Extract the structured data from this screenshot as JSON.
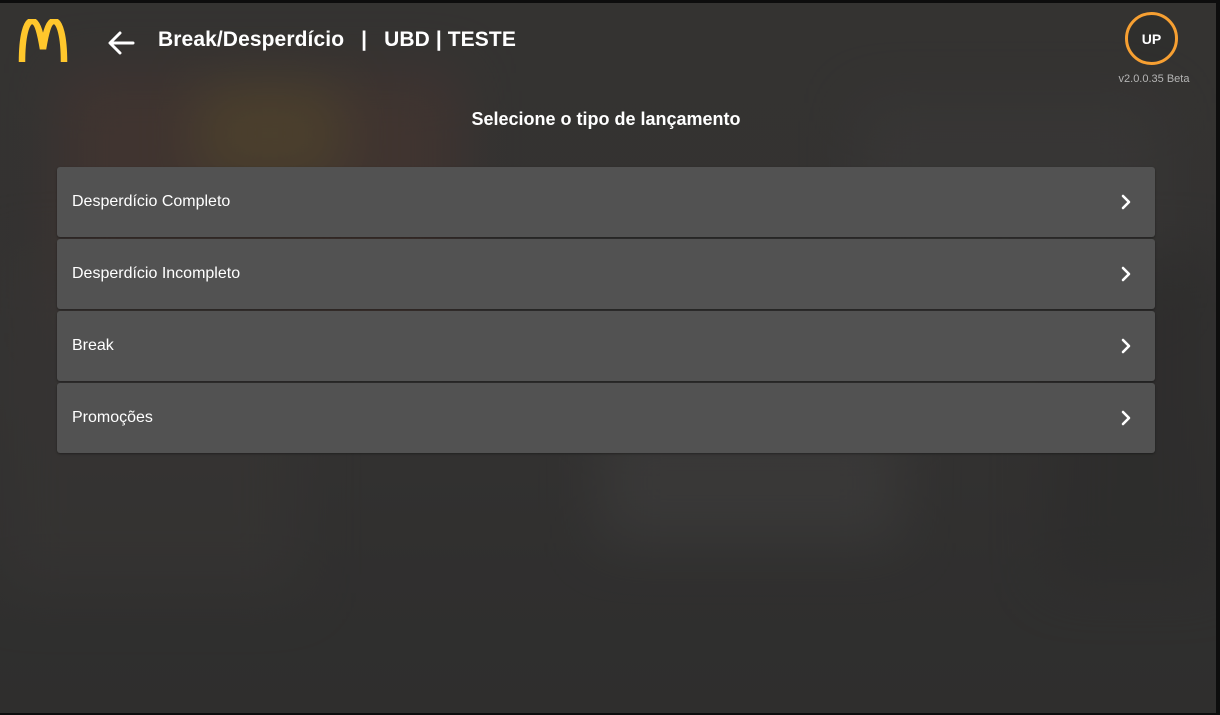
{
  "header": {
    "brand_logo": "mcdonalds-golden-arches-logo",
    "brand_color": "#ffc72c",
    "back_icon": "arrow-left-icon",
    "title": "Break/Desperdício",
    "separator": "|",
    "store": "UBD | TESTE"
  },
  "user": {
    "initials": "UP",
    "ring_color": "#f7a032",
    "version": "v2.0.0.35 Beta"
  },
  "main": {
    "prompt": "Selecione o tipo de lançamento",
    "options": [
      {
        "label": "Desperdício Completo",
        "icon": "chevron-right-icon"
      },
      {
        "label": "Desperdício Incompleto",
        "icon": "chevron-right-icon"
      },
      {
        "label": "Break",
        "icon": "chevron-right-icon"
      },
      {
        "label": "Promoções",
        "icon": "chevron-right-icon"
      }
    ]
  }
}
